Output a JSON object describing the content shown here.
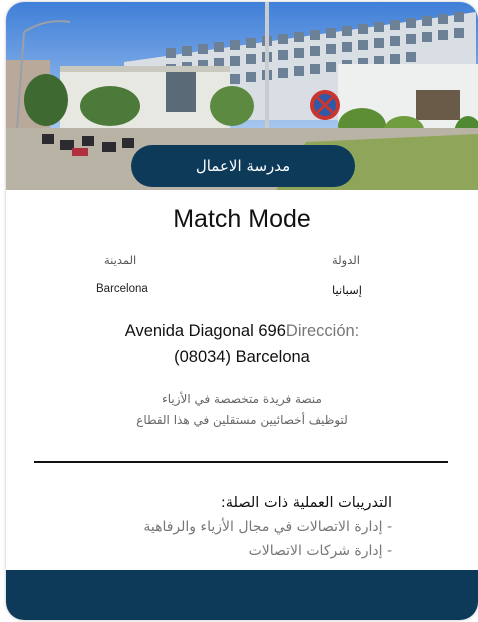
{
  "header": {
    "category_label": "مدرسة الاعمال"
  },
  "program": {
    "title": "Match Mode"
  },
  "details": {
    "country_label": "الدولة",
    "country_value": "إسبانيا",
    "city_label": "المدينة",
    "city_value": "Barcelona"
  },
  "address": {
    "label": "Dirección:",
    "line1": "Avenida Diagonal 696",
    "line2": "(08034) Barcelona"
  },
  "description": {
    "line1": "منصة فريدة متخصصة في الأزياء",
    "line2": "لتوظيف أخصائيين مستقلين في هذا القطاع"
  },
  "training": {
    "heading": "التدريبات العملية ذات الصلة:",
    "items": [
      "- إدارة الاتصالات في مجال الأزياء والرفاهية",
      "- إدارة شركات الاتصالات"
    ]
  },
  "colors": {
    "navy": "#0e3a5a"
  },
  "icons": {
    "no_entry_sign": "no-entry-sign-icon"
  }
}
